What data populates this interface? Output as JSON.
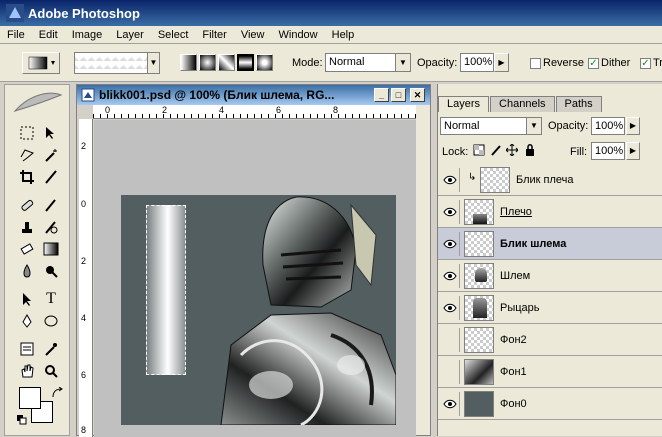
{
  "app": {
    "title": "Adobe Photoshop"
  },
  "menu": [
    "File",
    "Edit",
    "Image",
    "Layer",
    "Select",
    "Filter",
    "View",
    "Window",
    "Help"
  ],
  "options": {
    "mode_label": "Mode:",
    "mode_value": "Normal",
    "opacity_label": "Opacity:",
    "opacity_value": "100%",
    "reverse_label": "Reverse",
    "dither_label": "Dither",
    "transparency_label": "Tr"
  },
  "document": {
    "title": "blikk001.psd @ 100% (Блик шлема, RG...",
    "ruler_h_ticks": [
      "0",
      "2",
      "4",
      "6",
      "8"
    ],
    "ruler_v_ticks": [
      "2",
      "0",
      "2",
      "4",
      "6",
      "8"
    ]
  },
  "panel": {
    "tabs": [
      "Layers",
      "Channels",
      "Paths"
    ],
    "blend_mode": "Normal",
    "opacity_label": "Opacity:",
    "opacity_value": "100%",
    "lock_label": "Lock:",
    "fill_label": "Fill:",
    "fill_value": "100%",
    "layers": [
      {
        "name": "Блик плеча",
        "visible": true,
        "style": "normal"
      },
      {
        "name": "Плечо",
        "visible": true,
        "style": "underline"
      },
      {
        "name": "Блик шлема",
        "visible": true,
        "style": "bold"
      },
      {
        "name": "Шлем",
        "visible": true,
        "style": "normal"
      },
      {
        "name": "Рыцарь",
        "visible": true,
        "style": "normal"
      },
      {
        "name": "Фон2",
        "visible": false,
        "style": "normal"
      },
      {
        "name": "Фон1",
        "visible": false,
        "style": "normal"
      },
      {
        "name": "Фон0",
        "visible": true,
        "style": "normal"
      }
    ]
  },
  "colors": {
    "title_bar": "#0a246a",
    "canvas_bg": "#525e60",
    "selected_layer": "#c8cbd8"
  }
}
